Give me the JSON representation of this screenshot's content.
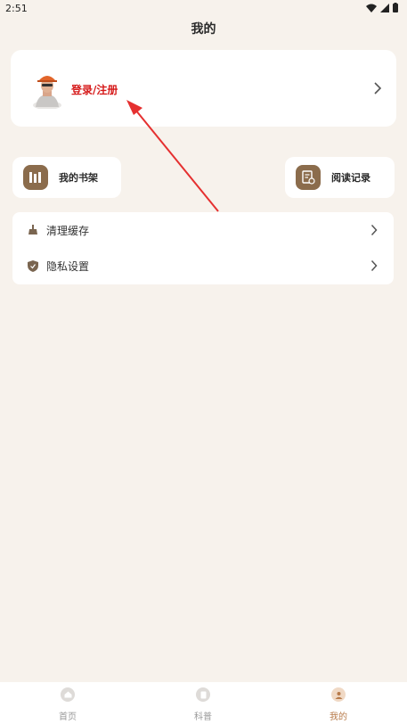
{
  "status_bar": {
    "time": "2:51"
  },
  "header": {
    "title": "我的"
  },
  "login_card": {
    "label": "登录/注册"
  },
  "quick_actions": {
    "shelf_label": "我的书架",
    "history_label": "阅读记录"
  },
  "settings": {
    "items": [
      {
        "label": "清理缓存",
        "icon": "broom-icon"
      },
      {
        "label": "隐私设置",
        "icon": "shield-icon"
      }
    ]
  },
  "tabbar": {
    "items": [
      {
        "label": "首页",
        "icon": "home-icon",
        "active": false
      },
      {
        "label": "科普",
        "icon": "document-icon",
        "active": false
      },
      {
        "label": "我的",
        "icon": "user-icon",
        "active": true
      }
    ]
  },
  "colors": {
    "background": "#f7f2ec",
    "accent_brown": "#8b6c4c",
    "login_red": "#d61b1b",
    "active_tab": "#b77a4a"
  }
}
